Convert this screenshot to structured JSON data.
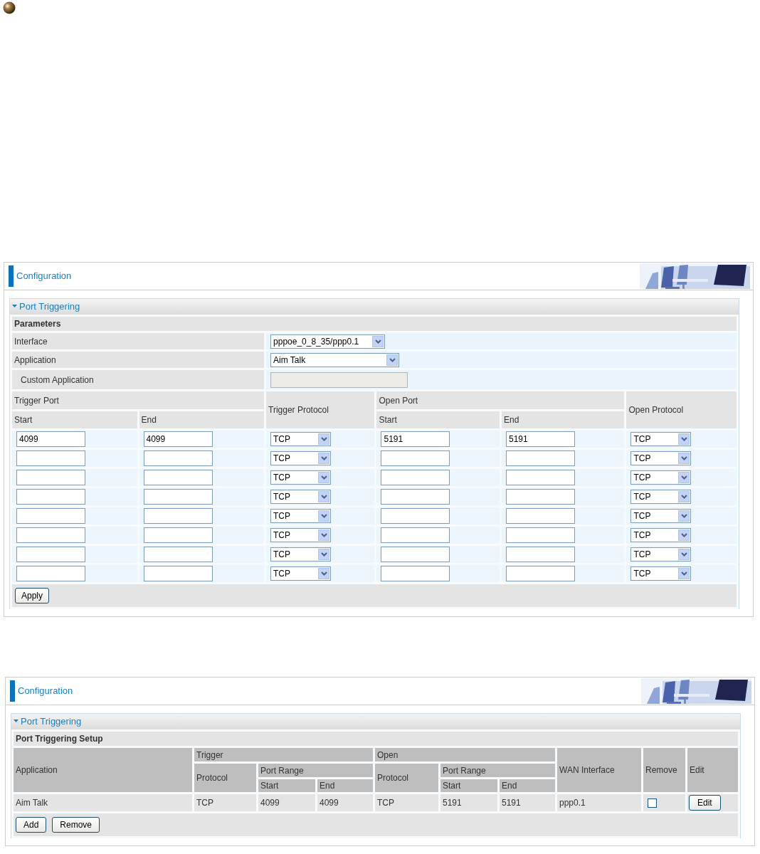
{
  "config_form": {
    "header": "Configuration",
    "section_title": "Port Triggering",
    "expanded": true,
    "group_title": "Parameters",
    "fields": [
      {
        "label": "Interface",
        "kind": "select",
        "value": "pppoe_0_8_35/ppp0.1"
      },
      {
        "label": "Application",
        "kind": "select",
        "value": "Aim Talk"
      },
      {
        "label": "Custom Application",
        "kind": "text",
        "disabled": true
      }
    ],
    "columns": {
      "trigger_port": {
        "label": "Trigger Port",
        "start": "Start",
        "end": "End"
      },
      "trigger_protocol": "Trigger Protocol",
      "open_port": {
        "label": "Open Port",
        "start": "Start",
        "end": "End"
      },
      "open_protocol": "Open Protocol"
    },
    "rows": [
      {
        "trigger_start": "4099",
        "trigger_end": "4099",
        "trigger_protocol": "TCP",
        "open_start": "5191",
        "open_end": "5191",
        "open_protocol": "TCP"
      },
      {
        "trigger_protocol": "TCP",
        "open_protocol": "TCP"
      },
      {
        "trigger_protocol": "TCP",
        "open_protocol": "TCP"
      },
      {
        "trigger_protocol": "TCP",
        "open_protocol": "TCP"
      },
      {
        "trigger_protocol": "TCP",
        "open_protocol": "TCP"
      },
      {
        "trigger_protocol": "TCP",
        "open_protocol": "TCP"
      },
      {
        "trigger_protocol": "TCP",
        "open_protocol": "TCP"
      },
      {
        "trigger_protocol": "TCP",
        "open_protocol": "TCP"
      }
    ],
    "buttons": [
      "Apply"
    ]
  },
  "config_list": {
    "header": "Configuration",
    "section_title": "Port Triggering",
    "expanded": true,
    "group_title": "Port Triggering Setup",
    "columns": {
      "application": "Application",
      "trigger": {
        "label": "Trigger",
        "protocol": "Protocol",
        "port_range": {
          "label": "Port Range",
          "start": "Start",
          "end": "End"
        }
      },
      "open": {
        "label": "Open",
        "protocol": "Protocol",
        "port_range": {
          "label": "Port Range",
          "start": "Start",
          "end": "End"
        }
      },
      "wan_interface": "WAN Interface",
      "remove": "Remove",
      "edit": "Edit"
    },
    "rows": [
      {
        "application": "Aim Talk",
        "trigger_protocol": "TCP",
        "trigger_start": "4099",
        "trigger_end": "4099",
        "open_protocol": "TCP",
        "open_start": "5191",
        "open_end": "5191",
        "wan_interface": "ppp0.1",
        "remove_checked": false,
        "edit_button": "Edit"
      }
    ],
    "buttons": [
      "Add",
      "Remove"
    ]
  }
}
